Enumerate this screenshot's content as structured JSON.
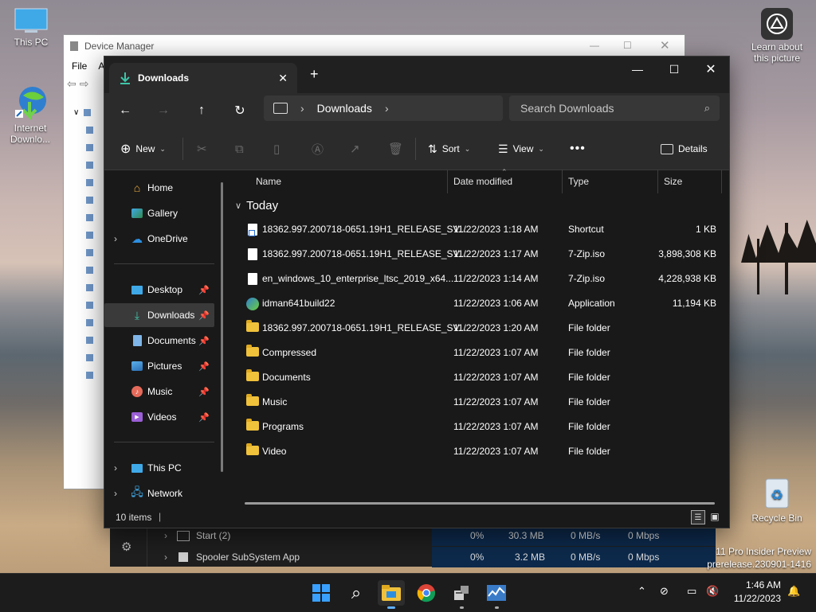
{
  "desktop": {
    "icons": [
      {
        "label": "This PC"
      },
      {
        "label": "Internet Downlo..."
      },
      {
        "label": "Recycle Bin"
      },
      {
        "label": "Learn about this picture"
      }
    ],
    "watermark_line1": "11 Pro Insider Preview",
    "watermark_line2": "prerelease.230901-1416"
  },
  "device_manager": {
    "title": "Device Manager",
    "menu_file": "File",
    "menu_action": "A"
  },
  "task_manager": {
    "rows": [
      {
        "name": "Start (2)",
        "cpu": "0%",
        "memory": "30.3 MB",
        "disk": "0 MB/s",
        "network": "0 Mbps"
      },
      {
        "name": "Spooler SubSystem App",
        "cpu": "0%",
        "memory": "3.2 MB",
        "disk": "0 MB/s",
        "network": "0 Mbps"
      }
    ]
  },
  "explorer": {
    "tab_title": "Downloads",
    "address": {
      "segment": "Downloads"
    },
    "search_placeholder": "Search Downloads",
    "commands": {
      "new": "New",
      "sort": "Sort",
      "view": "View",
      "details": "Details"
    },
    "nav": {
      "home": "Home",
      "gallery": "Gallery",
      "onedrive": "OneDrive",
      "desktop": "Desktop",
      "downloads": "Downloads",
      "documents": "Documents",
      "pictures": "Pictures",
      "music": "Music",
      "videos": "Videos",
      "thispc": "This PC",
      "network": "Network"
    },
    "columns": {
      "name": "Name",
      "date": "Date modified",
      "type": "Type",
      "size": "Size"
    },
    "group_label": "Today",
    "files": [
      {
        "name": "18362.997.200718-0651.19H1_RELEASE_SV...",
        "date": "11/22/2023 1:18 AM",
        "type": "Shortcut",
        "size": "1 KB",
        "icon": "shortcut-icon"
      },
      {
        "name": "18362.997.200718-0651.19H1_RELEASE_SV...",
        "date": "11/22/2023 1:17 AM",
        "type": "7-Zip.iso",
        "size": "3,898,308 KB",
        "icon": "file-icon"
      },
      {
        "name": "en_windows_10_enterprise_ltsc_2019_x64...",
        "date": "11/22/2023 1:14 AM",
        "type": "7-Zip.iso",
        "size": "4,228,938 KB",
        "icon": "file-icon"
      },
      {
        "name": "idman641build22",
        "date": "11/22/2023 1:06 AM",
        "type": "Application",
        "size": "11,194 KB",
        "icon": "app-icon"
      },
      {
        "name": "18362.997.200718-0651.19H1_RELEASE_SV...",
        "date": "11/22/2023 1:20 AM",
        "type": "File folder",
        "size": "",
        "icon": "folder-icon"
      },
      {
        "name": "Compressed",
        "date": "11/22/2023 1:07 AM",
        "type": "File folder",
        "size": "",
        "icon": "folder-icon"
      },
      {
        "name": "Documents",
        "date": "11/22/2023 1:07 AM",
        "type": "File folder",
        "size": "",
        "icon": "folder-icon"
      },
      {
        "name": "Music",
        "date": "11/22/2023 1:07 AM",
        "type": "File folder",
        "size": "",
        "icon": "folder-icon"
      },
      {
        "name": "Programs",
        "date": "11/22/2023 1:07 AM",
        "type": "File folder",
        "size": "",
        "icon": "folder-icon"
      },
      {
        "name": "Video",
        "date": "11/22/2023 1:07 AM",
        "type": "File folder",
        "size": "",
        "icon": "folder-icon"
      }
    ],
    "status": "10 items"
  },
  "taskbar": {
    "time": "1:46 AM",
    "date": "11/22/2023"
  },
  "colors": {
    "accent": "#0078d4",
    "folder": "#f0c13b",
    "explorer_bg": "#191919"
  }
}
